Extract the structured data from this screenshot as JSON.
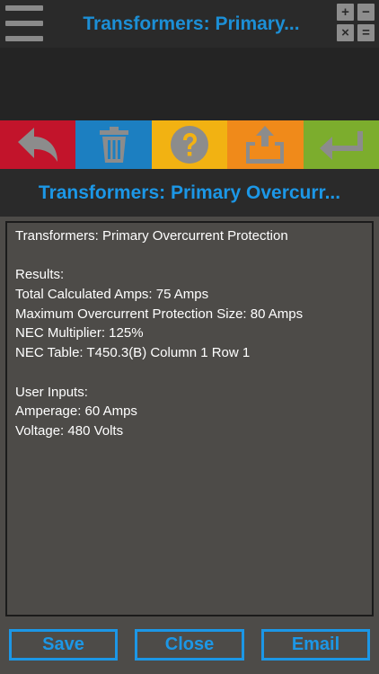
{
  "header": {
    "title": "Transformers: Primary...",
    "calc_keys": [
      "+",
      "−",
      "×",
      "="
    ]
  },
  "toolbar": {
    "colors": [
      "#c2142b",
      "#1c7fc1",
      "#f2b212",
      "#f08a1a",
      "#7cad2d"
    ],
    "icons": [
      "back-arrow-icon",
      "trash-icon",
      "help-icon",
      "share-icon",
      "return-icon"
    ]
  },
  "section": {
    "title": "Transformers: Primary Overcurr..."
  },
  "results": {
    "lines": [
      "Transformers: Primary Overcurrent Protection",
      "",
      "Results:",
      "Total Calculated Amps: 75 Amps",
      "Maximum Overcurrent Protection Size: 80 Amps",
      "NEC Multiplier: 125%",
      "NEC Table: T450.3(B) Column 1 Row 1",
      "",
      "User Inputs:",
      "Amperage: 60 Amps",
      "Voltage: 480 Volts"
    ]
  },
  "buttons": {
    "save": "Save",
    "close": "Close",
    "email": "Email"
  },
  "colors": {
    "accent": "#1c97e6",
    "background": "#4d4b48",
    "bar": "#2a2a2a"
  }
}
